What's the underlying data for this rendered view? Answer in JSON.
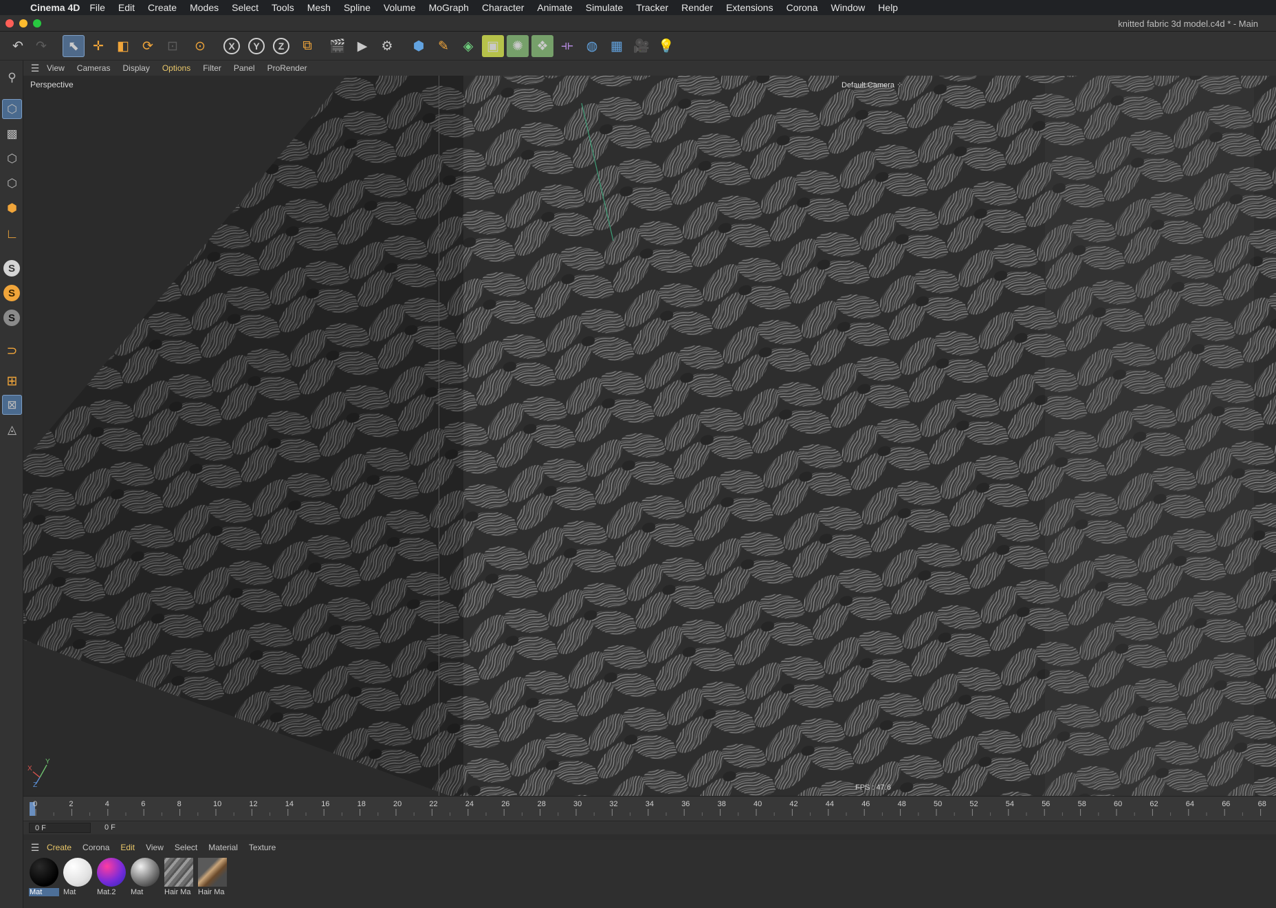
{
  "menubar": {
    "apple": "",
    "app_name": "Cinema 4D",
    "items": [
      "File",
      "Edit",
      "Create",
      "Modes",
      "Select",
      "Tools",
      "Mesh",
      "Spline",
      "Volume",
      "MoGraph",
      "Character",
      "Animate",
      "Simulate",
      "Tracker",
      "Render",
      "Extensions",
      "Corona",
      "Window",
      "Help"
    ]
  },
  "window": {
    "title": "knitted fabric 3d model.c4d * - Main"
  },
  "toolbar": {
    "undo": "↶",
    "redo": "↷",
    "select": "⬉",
    "move": "✛",
    "scale": "◧",
    "rotate": "⟳",
    "recent": "⊡",
    "live": "⊙",
    "axis_x": "X",
    "axis_y": "Y",
    "axis_z": "Z",
    "coord": "⧉",
    "render_view": "🎬",
    "render_pv": "▶",
    "render_settings": "⚙",
    "cube": "⬢",
    "pen": "✎",
    "subdiv": "◈",
    "extrude": "▣",
    "cloner": "✺",
    "mograph": "❖",
    "deformer": "⟛",
    "field": "◍",
    "floor": "▦",
    "camera": "🎥",
    "light": "💡",
    "colors": {
      "accent": "#4f6a8a",
      "highlight_green": "#76a06a",
      "highlight_yellow": "#b6c24a"
    }
  },
  "leftbar": {
    "top_icon": "⚲",
    "model": "⬡",
    "texture": "▩",
    "point": "⬡",
    "edge": "⬡",
    "poly": "⬢",
    "axis": "∟",
    "s1": "S",
    "s2": "S",
    "s3": "S",
    "magnet": "⊃",
    "workplane": "⊞",
    "grid": "⊠",
    "snap": "◬"
  },
  "viewport_menu": {
    "hamburger": "☰",
    "items": [
      "View",
      "Cameras",
      "Display",
      "Options",
      "Filter",
      "Panel",
      "ProRender"
    ],
    "active": "Options"
  },
  "viewport": {
    "label": "Perspective",
    "camera": "Default Camera ⁘",
    "fps": "FPS : 47.6",
    "gizmo": {
      "x": "X",
      "y": "Y",
      "z": "Z"
    }
  },
  "timeline": {
    "ticks": [
      "0",
      "2",
      "4",
      "6",
      "8",
      "10",
      "12",
      "14",
      "16",
      "18",
      "20",
      "22",
      "24",
      "26",
      "28",
      "30",
      "32",
      "34",
      "36",
      "38",
      "40",
      "42",
      "44",
      "46",
      "48",
      "50",
      "52",
      "54",
      "56",
      "58",
      "60",
      "62",
      "64",
      "66",
      "68"
    ]
  },
  "frame": {
    "start": "0 F",
    "current": "0 F"
  },
  "material_menu": {
    "hamburger": "☰",
    "items": [
      "Create",
      "Corona",
      "Edit",
      "View",
      "Select",
      "Material",
      "Texture"
    ],
    "active_items": [
      "Create",
      "Edit"
    ]
  },
  "materials": [
    {
      "name": "Mat",
      "selected": true
    },
    {
      "name": "Mat",
      "selected": false
    },
    {
      "name": "Mat.2",
      "selected": false
    },
    {
      "name": "Mat",
      "selected": false
    },
    {
      "name": "Hair Ma",
      "selected": false
    },
    {
      "name": "Hair Ma",
      "selected": false
    }
  ]
}
